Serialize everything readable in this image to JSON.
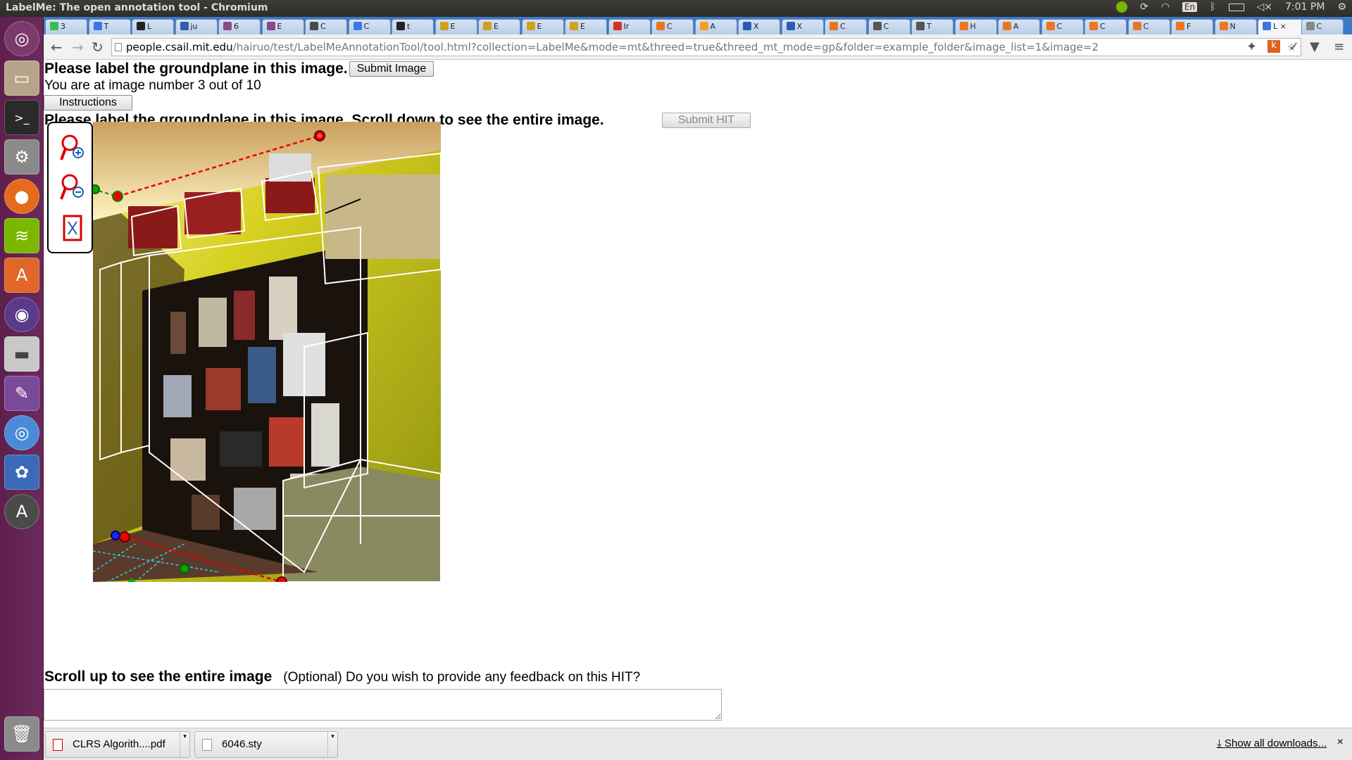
{
  "window": {
    "title": "LabelMe: The open annotation tool - Chromium"
  },
  "system_tray": {
    "keyboard": "En",
    "time": "7:01 PM"
  },
  "tabs": [
    {
      "label": "3",
      "color": "#3cba54"
    },
    {
      "label": "T",
      "color": "#3b78e7"
    },
    {
      "label": "L",
      "color": "#222222"
    },
    {
      "label": "ju",
      "color": "#2f5ea8"
    },
    {
      "label": "6",
      "color": "#8a4a8a"
    },
    {
      "label": "E",
      "color": "#8a4a8a"
    },
    {
      "label": "C",
      "color": "#4a4a4a"
    },
    {
      "label": "C",
      "color": "#3b78e7"
    },
    {
      "label": "t",
      "color": "#222222"
    },
    {
      "label": "E",
      "color": "#d0a020"
    },
    {
      "label": "E",
      "color": "#d0a020"
    },
    {
      "label": "E",
      "color": "#d0a020"
    },
    {
      "label": "E",
      "color": "#d0a020"
    },
    {
      "label": "Ir",
      "color": "#d93025"
    },
    {
      "label": "C",
      "color": "#e87722"
    },
    {
      "label": "A",
      "color": "#f0a020"
    },
    {
      "label": "X",
      "color": "#2b5cb0"
    },
    {
      "label": "X",
      "color": "#2b5cb0"
    },
    {
      "label": "C",
      "color": "#e87722"
    },
    {
      "label": "C",
      "color": "#555555"
    },
    {
      "label": "T",
      "color": "#555555"
    },
    {
      "label": "H",
      "color": "#e87722"
    },
    {
      "label": "A",
      "color": "#e87722"
    },
    {
      "label": "C",
      "color": "#e87722"
    },
    {
      "label": "C",
      "color": "#e87722"
    },
    {
      "label": "C",
      "color": "#e87722"
    },
    {
      "label": "F",
      "color": "#e87722"
    },
    {
      "label": "N",
      "color": "#e87722"
    },
    {
      "label": "L",
      "color": "#3b78e7"
    },
    {
      "label": "C",
      "color": "#888888"
    }
  ],
  "address": {
    "host": "people.csail.mit.edu",
    "path": "/hairuo/test/LabelMeAnnotationTool/tool.html?collection=LabelMe&mode=mt&threed=true&threed_mt_mode=gp&folder=example_folder&image_list=1&image=2"
  },
  "page": {
    "heading": "Please label the groundplane in this image.",
    "submit_image": "Submit Image",
    "progress_text": "You are at image number 3 out of 10",
    "instructions_button": "Instructions",
    "subheading": "Please label the groundplane in this image. Scroll down to see the entire image.",
    "submit_hit": "Submit HIT",
    "scroll_up_text": "Scroll up to see the entire image",
    "feedback_question": "(Optional) Do you wish to provide any feedback on this HIT?",
    "feedback_value": ""
  },
  "downloads": {
    "items": [
      {
        "name": "CLRS Algorith....pdf"
      },
      {
        "name": "6046.sty"
      }
    ],
    "show_all": "Show all downloads..."
  }
}
